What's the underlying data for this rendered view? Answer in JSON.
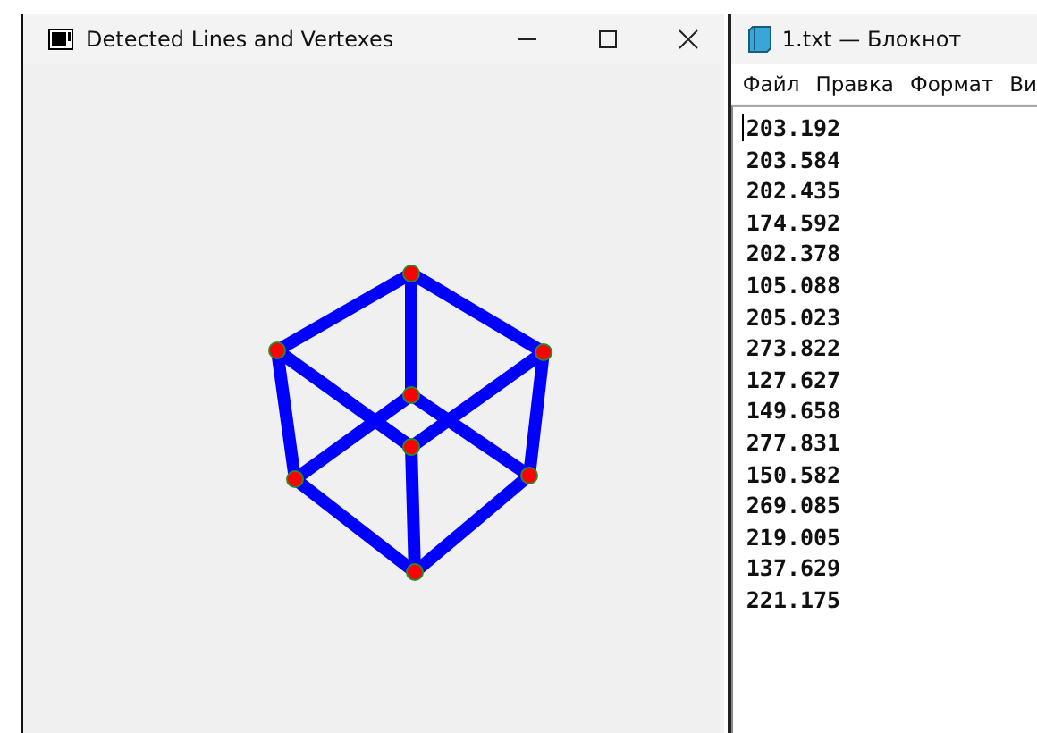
{
  "image_window": {
    "title": "Detected Lines and Vertexes"
  },
  "notepad": {
    "title": "1.txt — Блокнот",
    "menu": [
      "Файл",
      "Правка",
      "Формат",
      "Ви"
    ],
    "lines": [
      "203.192",
      "203.584",
      "202.435",
      "174.592",
      "202.378",
      "105.088",
      "205.023",
      "273.822",
      "127.627",
      "149.658",
      "277.831",
      "150.582",
      "269.085",
      "219.005",
      "137.629",
      "221.175"
    ]
  }
}
